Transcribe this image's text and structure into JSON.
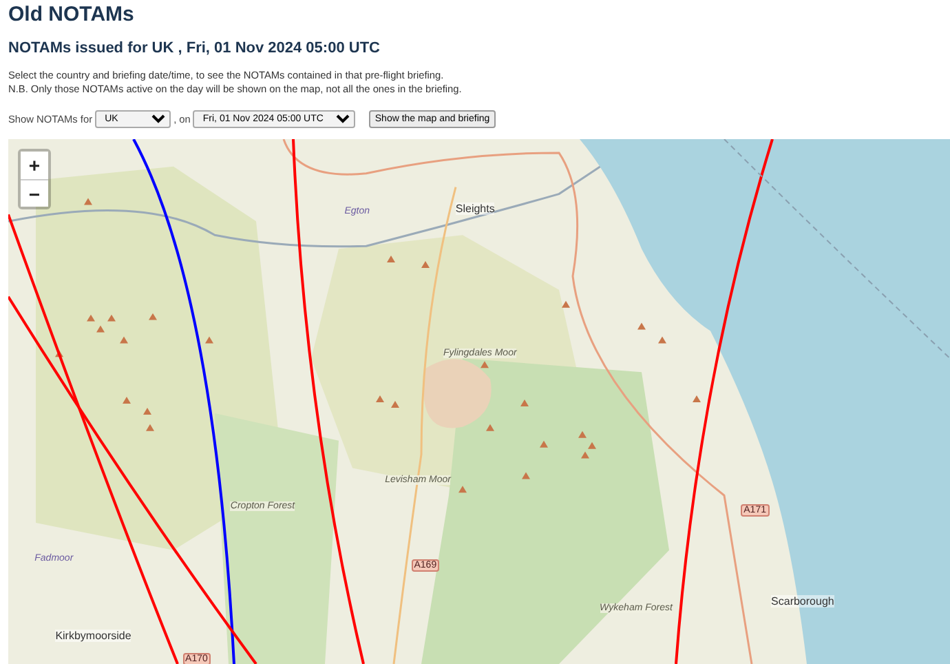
{
  "title": "Old NOTAMs",
  "subtitle": "NOTAMs issued for UK , Fri, 01 Nov 2024 05:00 UTC",
  "intro": [
    "Select the country and briefing date/time, to see the NOTAMs contained in that pre-flight briefing.",
    "N.B. Only those NOTAMs active on the day will be shown on the map, not all the ones in the briefing."
  ],
  "form": {
    "label": "Show NOTAMs for",
    "country": "UK",
    "separator": ", on",
    "briefing": "Fri, 01 Nov 2024 05:00 UTC",
    "button": "Show the map and briefing"
  },
  "map": {
    "zoom_in": "+",
    "zoom_out": "−",
    "labels": [
      {
        "text": "Egton",
        "kind": "village"
      },
      {
        "text": "Sleights",
        "kind": "town"
      },
      {
        "text": "Fylingdales Moor",
        "kind": "area"
      },
      {
        "text": "Cropton Forest",
        "kind": "area"
      },
      {
        "text": "Levisham Moor",
        "kind": "area"
      },
      {
        "text": "A169",
        "kind": "road"
      },
      {
        "text": "A171",
        "kind": "road"
      },
      {
        "text": "Fadmoor",
        "kind": "village"
      },
      {
        "text": "Kirkbymoorside",
        "kind": "town"
      },
      {
        "text": "Wykeham Forest",
        "kind": "area"
      },
      {
        "text": "Scarborough",
        "kind": "town"
      },
      {
        "text": "A170",
        "kind": "road"
      }
    ]
  }
}
